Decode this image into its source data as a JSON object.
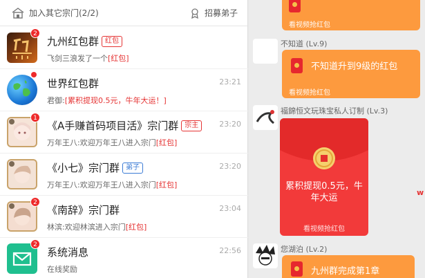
{
  "header": {
    "join_label": "加入其它宗门(2/2)",
    "recruit_label": "招募弟子"
  },
  "chat_list": [
    {
      "title": "九州红包群",
      "tag": "红包",
      "time": "",
      "msg_prefix": "飞剑三浪发了一个",
      "msg_hl": "[红包]",
      "badge": "2"
    },
    {
      "title": "世界红包群",
      "tag": "",
      "time": "23:21",
      "msg_prefix": "君御:",
      "msg_hl": "[累积提现0.5元，牛年大运！]",
      "badge": ""
    },
    {
      "title": "《A手赚首码项目活》宗门群",
      "tag": "宗主",
      "time": "23:20",
      "msg_prefix": "万年王八:欢迎万年王八进入宗门",
      "msg_hl": "[红包]",
      "badge": "1"
    },
    {
      "title": "《小七》宗门群",
      "tag": "弟子",
      "time": "23:20",
      "msg_prefix": "万年王八:欢迎万年王八进入宗门",
      "msg_hl": "[红包]",
      "badge": ""
    },
    {
      "title": "《南辞》宗门群",
      "tag": "",
      "time": "23:04",
      "msg_prefix": "林滨:欢迎林滨进入宗门",
      "msg_hl": "[红包]",
      "badge": "2"
    },
    {
      "title": "系统消息",
      "tag": "",
      "time": "22:56",
      "msg_prefix": "在线奖励",
      "msg_hl": "",
      "badge": "2"
    }
  ],
  "chat_area": {
    "msg0_sub": "看视频抢红包",
    "sender1": "不知道 (Lv.9)",
    "msg1_text": "不知道升到9级的红包",
    "msg1_sub": "看视频抢红包",
    "sender2": "福錦恒文玩珠宝私人订制 (Lv.3)",
    "msg2_text": "累积提现0.5元，牛年大运",
    "msg2_sub": "看视频抢红包",
    "sender3": "您湖泊 (Lv.2)",
    "msg3_text": "九州群完成第1章",
    "edge_mark": "w"
  },
  "colors": {
    "accent_red": "#e53333",
    "bubble_orange": "#fd9a3e",
    "big_red": "#f23a3a"
  }
}
